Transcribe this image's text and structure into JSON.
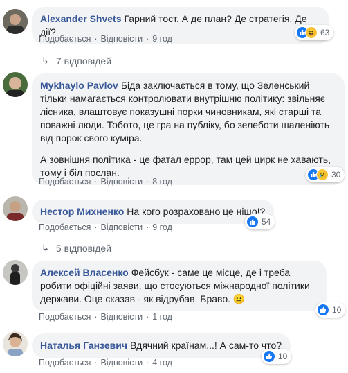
{
  "comments": [
    {
      "author": "Alexander Shvets",
      "text": "Гарний тост. А де план? Де стратегія. Де дії?",
      "like_label": "Подобається",
      "reply_label": "Відповісти",
      "time": "9 год",
      "reactions": [
        "like-icon",
        "haha-icon"
      ],
      "reaction_count": "63"
    },
    {
      "author": "Mykhaylo Pavlov",
      "text": "Біда заключається в тому, що Зеленський тільки намагається контролювати внутрішню політику: звільняє лісника, влаштовує показушні порки чиновникам, які старші та поважні люди. Тобото, це гра на публіку, бо зелеботи шаленіють від порок свого куміра.",
      "text2": "А зовнішня політика - це фатал еррор, там цей цирк не хавають, тому і біл послан.",
      "like_label": "Подобається",
      "reply_label": "Відповісти",
      "time": "8 год",
      "reactions": [
        "like-icon",
        "sad-icon"
      ],
      "reaction_count": "30"
    },
    {
      "author": "Нестор Михненко",
      "text": "На кого розраховано це ніщо!?",
      "like_label": "Подобається",
      "reply_label": "Відповісти",
      "time": "9 год",
      "reactions": [
        "like-icon"
      ],
      "reaction_count": "54"
    },
    {
      "author": "Алексей Власенко",
      "text": "Фейсбук - саме це місце, де і треба робити офіційні заяви, що стосуються міжнародної політики держави. Оце сказав - як відрубав. Браво. 😐",
      "like_label": "Подобається",
      "reply_label": "Відповісти",
      "time": "1 год",
      "reactions": [
        "like-icon"
      ],
      "reaction_count": "10"
    },
    {
      "author": "Наталья Ганзевич",
      "text": "Вдячний країнам...! А сам-то что?",
      "like_label": "Подобається",
      "reply_label": "Відповісти",
      "time": "4 год",
      "reactions": [
        "like-icon"
      ],
      "reaction_count": "10"
    }
  ],
  "reply_threads": [
    {
      "label": "7 відповідей"
    },
    {
      "label": "5 відповідей"
    }
  ],
  "colors": {
    "author": "#385898",
    "bubble": "#f2f3f5",
    "like": "#1877f2",
    "meta": "#606770"
  }
}
